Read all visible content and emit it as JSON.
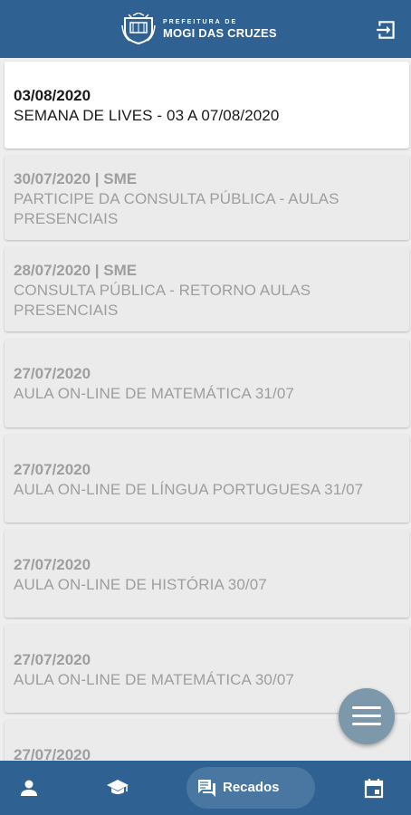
{
  "header": {
    "logo_small": "PREFEITURA DE",
    "logo_big": "MOGI DAS CRUZES"
  },
  "messages": [
    {
      "date": "03/08/2020",
      "title": "SEMANA DE LIVES - 03 A 07/08/2020",
      "read": true
    },
    {
      "date": "30/07/2020 | SME",
      "title": "PARTICIPE DA CONSULTA PÚBLICA - AULAS PRESENCIAIS",
      "read": false
    },
    {
      "date": "28/07/2020 | SME",
      "title": "CONSULTA PÚBLICA - RETORNO AULAS PRESENCIAIS",
      "read": false
    },
    {
      "date": "27/07/2020",
      "title": "AULA ON-LINE DE MATEMÁTICA 31/07",
      "read": false
    },
    {
      "date": "27/07/2020",
      "title": "AULA ON-LINE DE LÍNGUA PORTUGUESA 31/07",
      "read": false
    },
    {
      "date": "27/07/2020",
      "title": "AULA ON-LINE DE HISTÓRIA 30/07",
      "read": false
    },
    {
      "date": "27/07/2020",
      "title": "AULA ON-LINE DE MATEMÁTICA 30/07",
      "read": false
    },
    {
      "date": "27/07/2020",
      "title": "",
      "read": false
    }
  ],
  "bottom_nav": {
    "items": [
      {
        "icon": "person-icon"
      },
      {
        "icon": "graduation-cap-icon"
      },
      {
        "icon": "chat-icon",
        "label": "Recados",
        "active": true
      },
      {
        "icon": "calendar-icon"
      }
    ]
  },
  "colors": {
    "primary": "#2f6193",
    "card_unread": "#ebebeb",
    "card_read": "#ffffff",
    "fab": "#7d98ab"
  }
}
